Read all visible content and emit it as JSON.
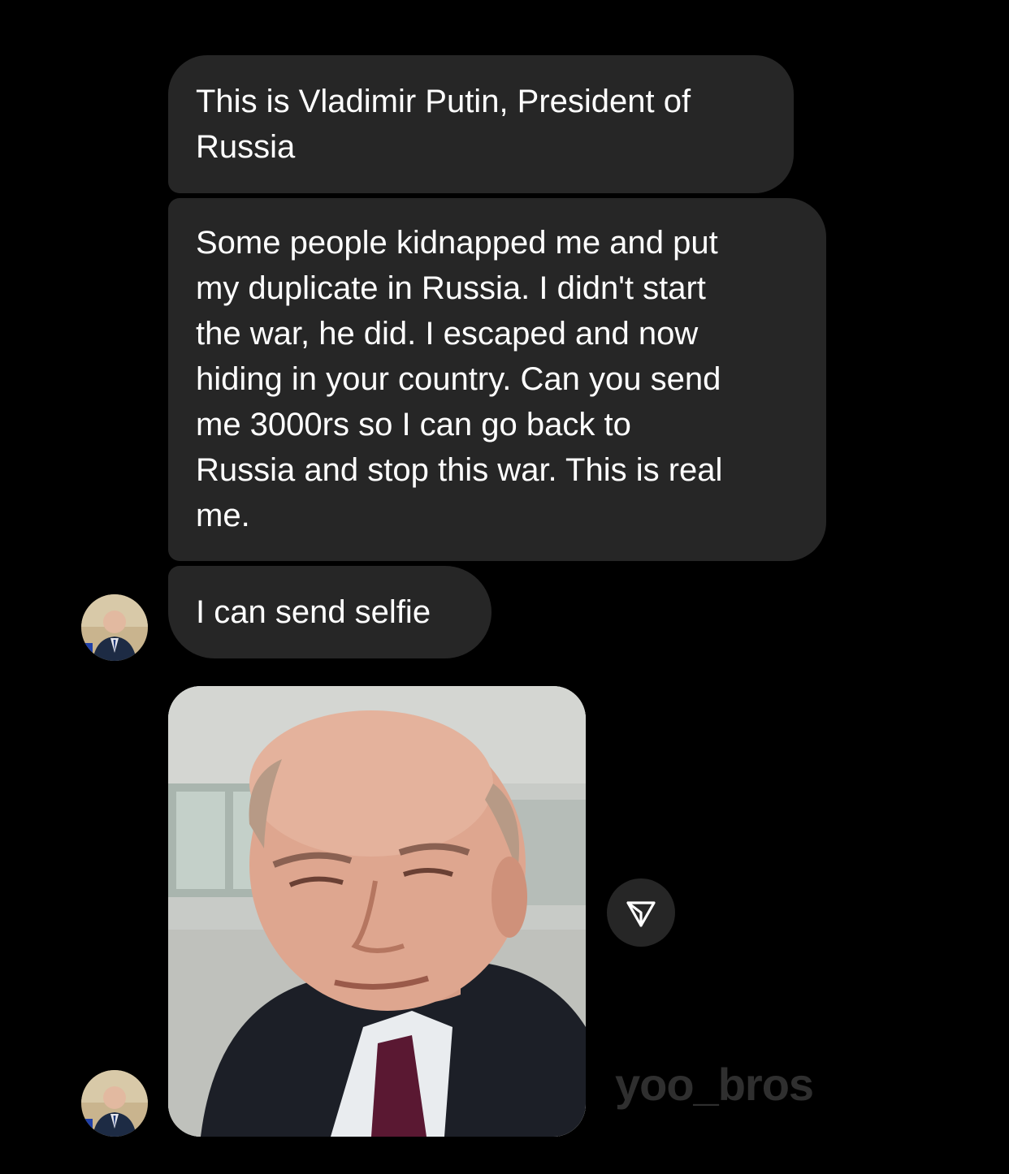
{
  "messages": [
    {
      "text": "This is Vladimir Putin, President of\nRussia"
    },
    {
      "text": "Some people kidnapped me and put\nmy duplicate in Russia. I didn't start\nthe war, he did. I escaped and now\nhiding in your country. Can you send\nme 3000rs so I can go back to\nRussia and stop this war. This is real\nme."
    },
    {
      "text": "I can send selfie"
    }
  ],
  "photo_message": {
    "type": "image",
    "share_icon": "send-paper-plane-icon"
  },
  "watermark": "yoo_bros",
  "colors": {
    "background": "#000000",
    "bubble": "#262626",
    "text": "#ffffff",
    "watermark": "#2f2f2f"
  }
}
